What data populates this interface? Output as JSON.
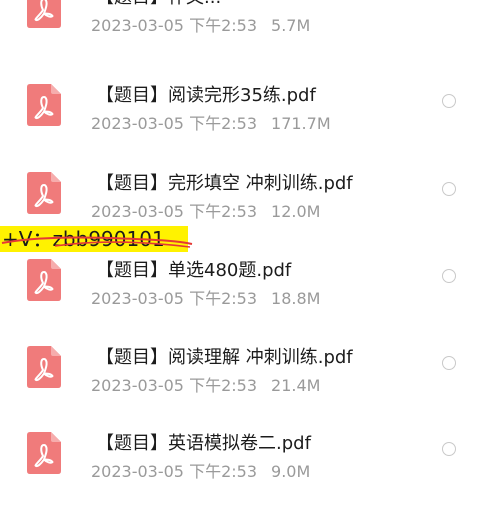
{
  "files": [
    {
      "name": "【题目】作文...",
      "date": "2023-03-05 下午2:53",
      "size": "5.7M"
    },
    {
      "name": "【题目】阅读完形35练.pdf",
      "date": "2023-03-05 下午2:53",
      "size": "171.7M"
    },
    {
      "name": "【题目】完形填空 冲刺训练.pdf",
      "date": "2023-03-05 下午2:53",
      "size": "12.0M"
    },
    {
      "name": "【题目】单选480题.pdf",
      "date": "2023-03-05 下午2:53",
      "size": "18.8M"
    },
    {
      "name": "【题目】阅读理解 冲刺训练.pdf",
      "date": "2023-03-05 下午2:53",
      "size": "21.4M"
    },
    {
      "name": "【题目】英语模拟卷二.pdf",
      "date": "2023-03-05 下午2:53",
      "size": "9.0M"
    }
  ],
  "watermark": {
    "text": "+V：zbb990101"
  },
  "colors": {
    "pdf_icon": "#f07b7b",
    "highlight": "#fff200",
    "strike": "#e53935",
    "meta_text": "#9a9a9a"
  },
  "icons": {
    "file": "pdf-file-icon",
    "select": "radio-circle-icon"
  }
}
